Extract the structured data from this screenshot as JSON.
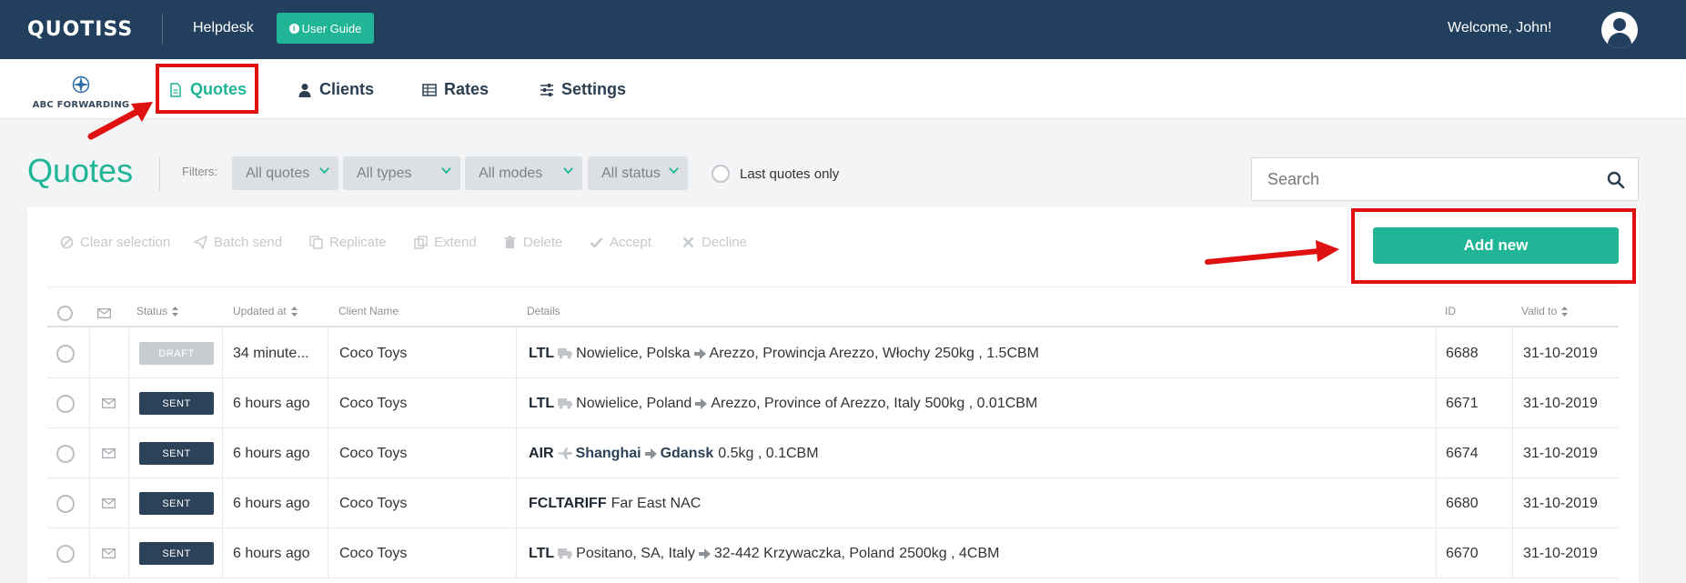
{
  "topbar": {
    "logo": "QUOTISS",
    "helpdesk": "Helpdesk",
    "user_guide": "User Guide",
    "welcome": "Welcome, John!"
  },
  "nav": {
    "company": "ABC FORWARDING",
    "items": [
      {
        "label": "Quotes",
        "icon": "document-icon",
        "active": true
      },
      {
        "label": "Clients",
        "icon": "user-icon"
      },
      {
        "label": "Rates",
        "icon": "table-icon"
      },
      {
        "label": "Settings",
        "icon": "sliders-icon"
      }
    ]
  },
  "page": {
    "title": "Quotes",
    "filters_label": "Filters:",
    "filters": [
      "All quotes",
      "All types",
      "All modes",
      "All status"
    ],
    "last_quotes_only": "Last quotes only",
    "search_placeholder": "Search"
  },
  "actions": [
    "Clear selection",
    "Batch send",
    "Replicate",
    "Extend",
    "Delete",
    "Accept",
    "Decline"
  ],
  "add_new": "Add new",
  "table": {
    "headers": [
      "Status",
      "Updated at",
      "Client Name",
      "Details",
      "ID",
      "Valid to"
    ],
    "rows": [
      {
        "status": "DRAFT",
        "updated": "34 minute...",
        "client": "Coco Toys",
        "mode": "LTL",
        "from": "Nowielice, Polska",
        "to": "Arezzo, Prowincja Arezzo, Włochy",
        "extra": "250kg , 1.5CBM",
        "id": "6688",
        "valid": "31-10-2019"
      },
      {
        "status": "SENT",
        "updated": "6 hours ago",
        "client": "Coco Toys",
        "mode": "LTL",
        "from": "Nowielice, Poland",
        "to": "Arezzo, Province of Arezzo, Italy",
        "extra": "500kg , 0.01CBM",
        "id": "6671",
        "valid": "31-10-2019"
      },
      {
        "status": "SENT",
        "updated": "6 hours ago",
        "client": "Coco Toys",
        "mode": "AIR",
        "from": "Shanghai",
        "to": "Gdansk",
        "extra": "0.5kg , 0.1CBM",
        "id": "6674",
        "valid": "31-10-2019"
      },
      {
        "status": "SENT",
        "updated": "6 hours ago",
        "client": "Coco Toys",
        "mode": "FCLTARIFF",
        "from": "",
        "to": "",
        "extra": "Far East NAC",
        "id": "6680",
        "valid": "31-10-2019"
      },
      {
        "status": "SENT",
        "updated": "6 hours ago",
        "client": "Coco Toys",
        "mode": "LTL",
        "from": "Positano, SA, Italy",
        "to": "32-442 Krzywaczka, Poland",
        "extra": "2500kg , 4CBM",
        "id": "6670",
        "valid": "31-10-2019"
      }
    ]
  },
  "colors": {
    "brand": "#21b598",
    "topbar": "#22405e",
    "highlight": "#e01111"
  }
}
